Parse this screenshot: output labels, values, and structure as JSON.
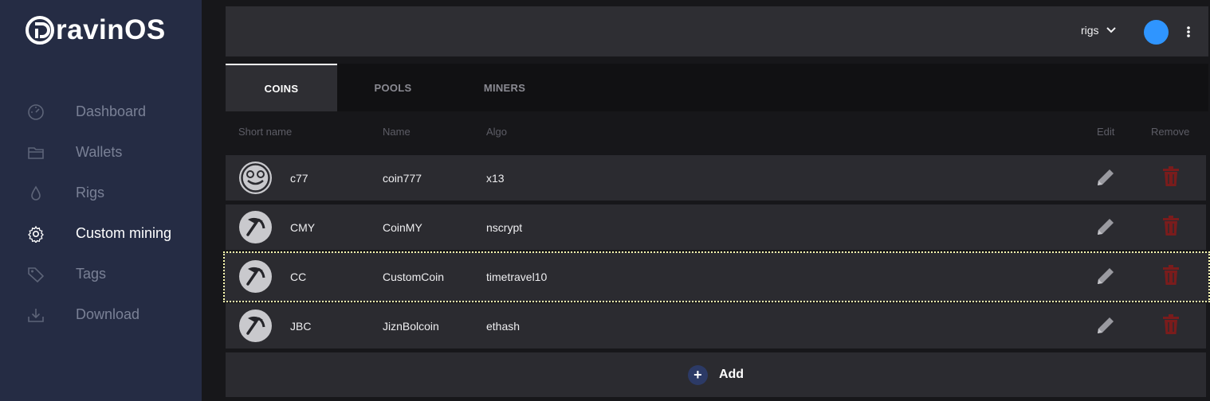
{
  "brand": {
    "name": "ravinOS",
    "logo_icon": "ravinos-logo-icon"
  },
  "sidebar": {
    "items": [
      {
        "label": "Dashboard",
        "icon": "speedometer-icon",
        "active": false
      },
      {
        "label": "Wallets",
        "icon": "folder-icon",
        "active": false
      },
      {
        "label": "Rigs",
        "icon": "drop-icon",
        "active": false
      },
      {
        "label": "Custom mining",
        "icon": "gear-icon",
        "active": true
      },
      {
        "label": "Tags",
        "icon": "tag-icon",
        "active": false
      },
      {
        "label": "Download",
        "icon": "download-icon",
        "active": false
      }
    ]
  },
  "topbar": {
    "rigs_label": "rigs",
    "rigs_icon": "chevron-down-icon",
    "avatar_color": "#2f95ff",
    "menu_icon": "kebab-menu-icon"
  },
  "tabs": [
    {
      "label": "COINS",
      "active": true
    },
    {
      "label": "POOLS",
      "active": false
    },
    {
      "label": "MINERS",
      "active": false
    }
  ],
  "table": {
    "headers": {
      "short_name": "Short name",
      "name": "Name",
      "algo": "Algo",
      "edit": "Edit",
      "remove": "Remove"
    },
    "rows": [
      {
        "short": "c77",
        "name": "coin777",
        "algo": "x13",
        "icon": "smiley-coin-icon"
      },
      {
        "short": "CMY",
        "name": "CoinMY",
        "algo": "nscrypt",
        "icon": "pickaxe-icon"
      },
      {
        "short": "CC",
        "name": "CustomCoin",
        "algo": "timetravel10",
        "icon": "pickaxe-icon"
      },
      {
        "short": "JBC",
        "name": "JiznBolcoin",
        "algo": "ethash",
        "icon": "pickaxe-icon"
      }
    ]
  },
  "add": {
    "label": "Add",
    "icon": "+"
  },
  "colors": {
    "sidebar": "#252c44",
    "remove": "#7a1c1c",
    "accent": "#2f95ff"
  }
}
